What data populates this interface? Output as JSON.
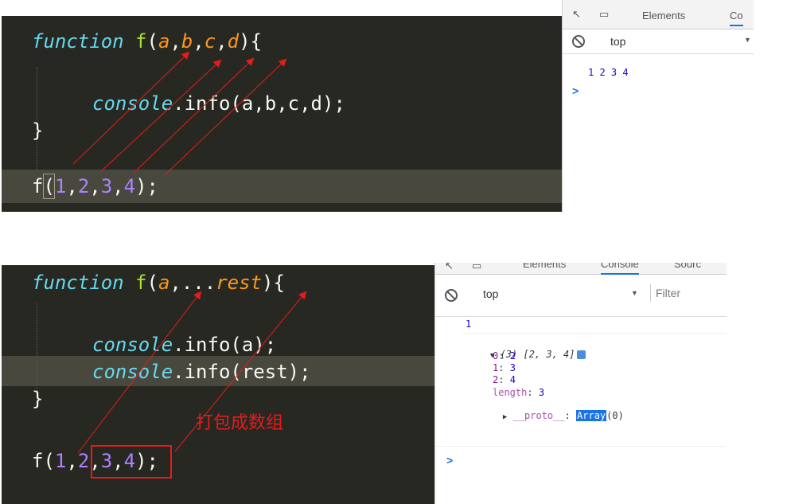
{
  "example1": {
    "code": {
      "kw_function": "function",
      "fn_name": "f",
      "params": [
        "a",
        "b",
        "c",
        "d"
      ],
      "body": "console.info(a,b,c,d);",
      "body_obj": "console",
      "body_rest": ".info(a,b,c,d);",
      "close": "}",
      "call_name": "f",
      "args": [
        "1",
        "2",
        "3",
        "4"
      ]
    },
    "devtools": {
      "tabs": [
        "Elements",
        "Co"
      ],
      "context": "top",
      "output": "1 2 3 4",
      "prompt": ">"
    }
  },
  "example2": {
    "code": {
      "kw_function": "function",
      "fn_name": "f",
      "param_a": "a",
      "spread": "...",
      "param_rest": "rest",
      "line2_obj": "console",
      "line2_rest": ".info(a);",
      "line3_obj": "console",
      "line3_rest": ".info(rest);",
      "close": "}",
      "call_name": "f",
      "args": [
        "1",
        "2",
        "3",
        "4"
      ]
    },
    "annotation": "打包成数组",
    "devtools": {
      "tabs": [
        "Elements",
        "Console",
        "Sourc"
      ],
      "context": "top",
      "filter_placeholder": "Filter",
      "output_first": "1",
      "array_summary": "(3) [2, 3, 4]",
      "entries": [
        {
          "key": "0",
          "value": "2"
        },
        {
          "key": "1",
          "value": "3"
        },
        {
          "key": "2",
          "value": "4"
        }
      ],
      "length_key": "length",
      "length_value": "3",
      "proto_key": "__proto__",
      "proto_type": "Array",
      "proto_count": "(0)",
      "prompt": ">"
    }
  },
  "colors": {
    "editor_bg": "#272822",
    "keyword": "#66d9ef",
    "function_name": "#a6e22e",
    "parameter": "#fd971f",
    "number": "#ae81ff",
    "annotation_red": "#e51c1c"
  }
}
